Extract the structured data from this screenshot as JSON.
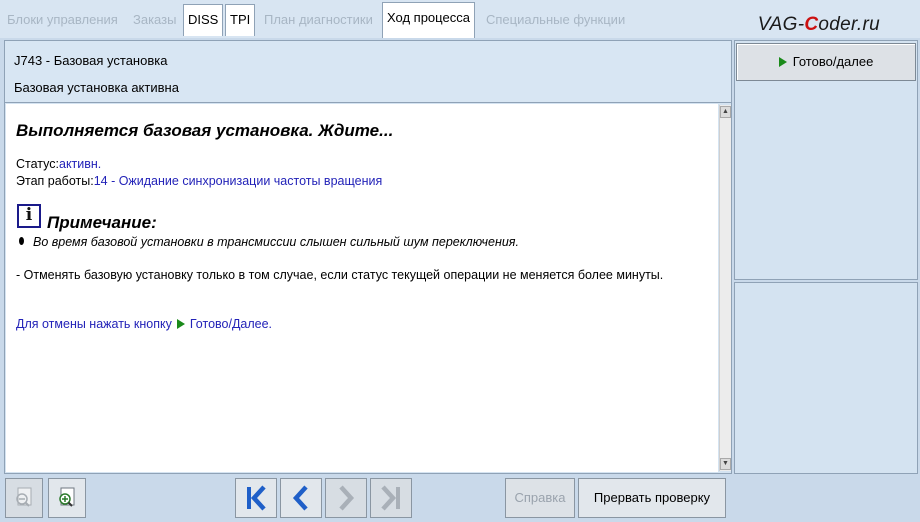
{
  "tabs": [
    {
      "label": "Блоки управления",
      "state": "disabled"
    },
    {
      "label": "Заказы",
      "state": "disabled"
    },
    {
      "label": "DISS",
      "state": "enabled"
    },
    {
      "label": "TPI",
      "state": "enabled"
    },
    {
      "label": "План диагностики",
      "state": "disabled"
    },
    {
      "label": "Ход процесса",
      "state": "active"
    },
    {
      "label": "Специальные функции",
      "state": "disabled"
    }
  ],
  "logo": {
    "prefix": "VAG-",
    "accent": "C",
    "suffix": "oder.ru"
  },
  "header": {
    "line1": "J743 - Базовая установка",
    "line2": "Базовая установка активна"
  },
  "content": {
    "title": "Выполняется базовая установка. Ждите...",
    "status_label": "Статус:",
    "status_value": "активн.",
    "stage_label": "Этап работы:",
    "stage_value": "14 - Ожидание синхронизации частоты вращения",
    "note_icon_glyph": "i",
    "note_title": "Примечание:",
    "note_text": "Во время базовой установки в трансмиссии слышен сильный шум переключения.",
    "description": "- Отменять базовую установку только в том случае, если статус текущей операции не меняется более минуты.",
    "cancel_text": "Для отмены нажать кнопку",
    "cancel_target": "Готово/Далее."
  },
  "right_panel": {
    "ready_button": "Готово/далее"
  },
  "toolbar": {
    "help_button": "Справка",
    "abort_button": "Прервать проверку"
  },
  "colors": {
    "link_blue": "#2323b8",
    "arrow_green": "#1a8a1a",
    "nav_blue": "#1f5fc8",
    "panel_bg": "#d4e3f1"
  }
}
